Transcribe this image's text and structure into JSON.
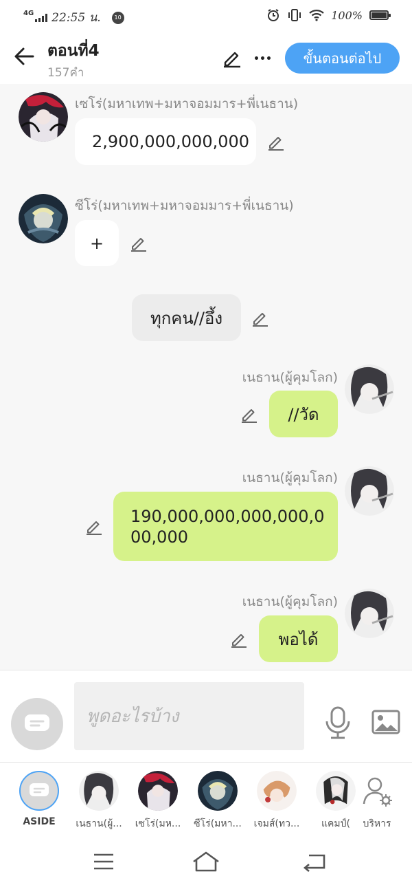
{
  "status_bar": {
    "network": "4G",
    "time": "22:55 น.",
    "notification_badge": "10",
    "battery": "100%"
  },
  "header": {
    "title": "ตอนที่4",
    "word_count": "157คำ",
    "next_step_label": "ขั้นตอนต่อไป"
  },
  "messages": [
    {
      "side": "left",
      "sender": "เซโร่(มหาเทพ+มหาจอมมาร+พี่เนธาน)",
      "text": "2,900,000,000,000",
      "avatar": "zero-red-avatar"
    },
    {
      "side": "left",
      "sender": "ซีโร่(มหาเทพ+มหาจอมมาร+พี่เนธาน)",
      "text": "+",
      "avatar": "zero-blue-avatar"
    },
    {
      "side": "narration",
      "sender": "",
      "text": "ทุกคน//อึ้ง"
    },
    {
      "side": "right",
      "sender": "เนธาน(ผู้คุมโลก)",
      "text": "//วัด",
      "avatar": "nethan-avatar"
    },
    {
      "side": "right",
      "sender": "เนธาน(ผู้คุมโลก)",
      "text": "190,000,000,000,000,0\n00,000",
      "avatar": "nethan-avatar"
    },
    {
      "side": "right",
      "sender": "เนธาน(ผู้คุมโลก)",
      "text": "พอได้",
      "avatar": "nethan-avatar"
    }
  ],
  "composer": {
    "placeholder": "พูดอะไรบ้าง"
  },
  "characters": [
    {
      "label": "ASIDE",
      "icon": "chat-bubble-icon",
      "selected": true
    },
    {
      "label": "เนธาน(ผู้...",
      "icon": "nethan-avatar"
    },
    {
      "label": "เซโร่(มห...",
      "icon": "zero-red-avatar"
    },
    {
      "label": "ซีโร่(มหา...",
      "icon": "zero-blue-avatar"
    },
    {
      "label": "เจมส์(ทว...",
      "icon": "james-avatar"
    },
    {
      "label": "แคมป์(",
      "icon": "camp-avatar"
    },
    {
      "label": "บริหาร",
      "icon": "manage-characters-icon"
    }
  ],
  "colors": {
    "accent_blue": "#4da3f5",
    "own_bubble": "#d6f28a",
    "other_bubble": "#ffffff",
    "narration_bubble": "#ececec",
    "background": "#f7f7f7"
  }
}
